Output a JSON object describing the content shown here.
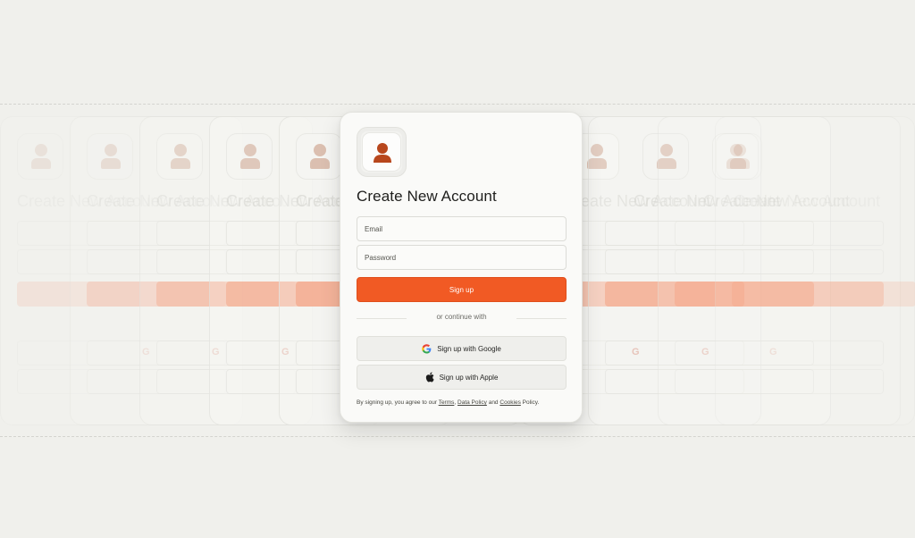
{
  "card": {
    "title": "Create New Account",
    "email_placeholder": "Email",
    "password_placeholder": "Password",
    "signup_label": "Sign up",
    "divider_text": "or continue with",
    "google_label": "Sign up with Google",
    "apple_label": "Sign up with Apple",
    "legal": {
      "prefix": "By signing up, you agree to our",
      "terms": "Terms",
      "comma": ",",
      "data_policy": "Data Policy",
      "and": "and",
      "cookies": "Cookies",
      "suffix": "Policy."
    }
  },
  "ghost_title": "Create New Account",
  "icons": {
    "avatar": "user-icon",
    "google": "google-icon",
    "apple": "apple-icon"
  },
  "colors": {
    "accent": "#f15a24",
    "background": "#f0f0ec",
    "card": "#fafaf8",
    "avatar": "#b8471d"
  }
}
